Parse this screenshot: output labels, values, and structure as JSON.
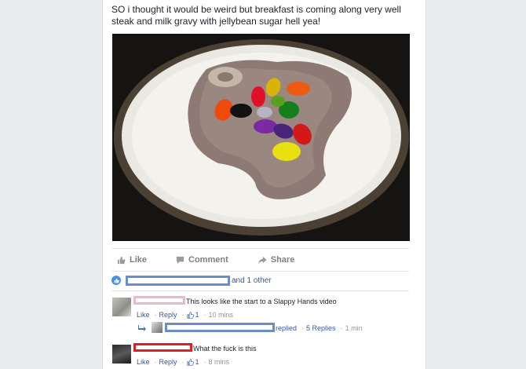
{
  "post": {
    "text_line1": "SO i thought it would be weird but breakfast is coming along very well",
    "text_line2": "steak and milk gravy with jellybean sugar hell yea!"
  },
  "actions": {
    "like": "Like",
    "comment": "Comment",
    "share": "Share"
  },
  "likes": {
    "suffix": "and 1 other"
  },
  "comments": [
    {
      "text": "This looks like the start to a Slappy Hands video",
      "like": "Like",
      "reply": "Reply",
      "reactions": "1",
      "time": "10 mins",
      "replies_text": "replied",
      "replies_count": "5 Replies",
      "replies_time": "1 min"
    },
    {
      "text": "What the fuck is this",
      "like": "Like",
      "reply": "Reply",
      "reactions": "1",
      "time": "8 mins"
    }
  ],
  "colors": {
    "link": "#365899",
    "censor_blue": "#6a8fc8",
    "censor_pink": "#f0b6c9",
    "censor_red": "#e11d2a"
  }
}
